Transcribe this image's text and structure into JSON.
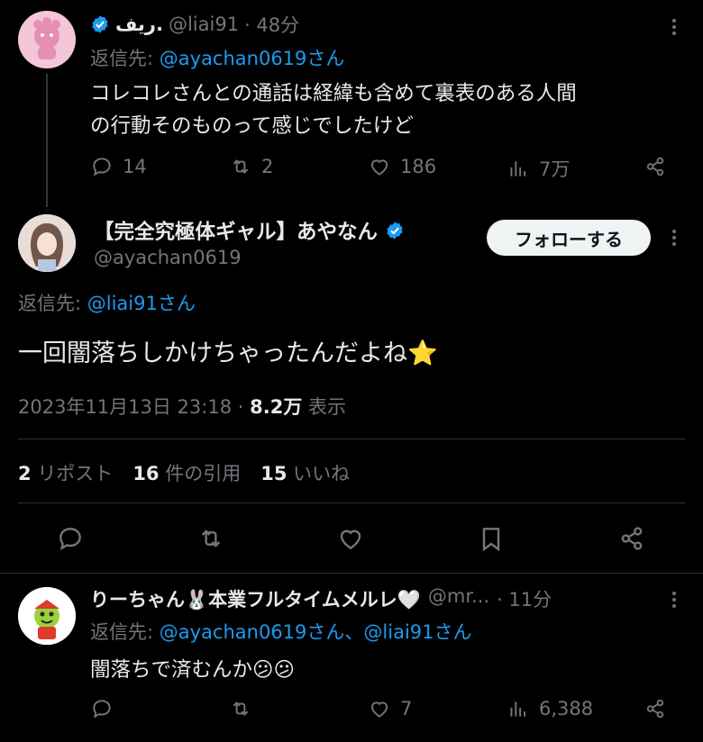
{
  "tweet1": {
    "display_name": "ريف.",
    "handle": "@liai91",
    "time": "· 48分",
    "reply_to_label": "返信先:",
    "reply_to_handle": "@ayachan0619さん",
    "text_line1": "コレコレさんとの通話は経緯も含めて裏表のある人間",
    "text_line2": "の行動そのものって感じでしたけど",
    "replies": "14",
    "reposts": "2",
    "likes": "186",
    "views": "7万"
  },
  "tweet2": {
    "display_name": "【完全究極体ギャル】あやなん",
    "handle": "@ayachan0619",
    "follow_label": "フォローする",
    "reply_to_label": "返信先:",
    "reply_to_handle": "@liai91さん",
    "text": "一回闇落ちしかけちゃったんだよね⭐",
    "timestamp": "2023年11月13日 23:18 ·",
    "views_count": "8.2万",
    "views_label": "表示",
    "reposts_count": "2",
    "reposts_label": "リポスト",
    "quotes_count": "16",
    "quotes_label": "件の引用",
    "likes_count": "15",
    "likes_label": "いいね"
  },
  "tweet3": {
    "display_name": "りーちゃん🐰本業フルタイムメルレ🤍",
    "handle": "@mr...",
    "time": "· 11分",
    "reply_to_label": "返信先:",
    "reply_to_handles": "@ayachan0619さん、@liai91さん",
    "text": "闇落ちで済むんか😕😕",
    "likes": "7",
    "views": "6,388"
  },
  "colors": {
    "background": "#000000",
    "text": "#e7e9ea",
    "secondary": "#71767b",
    "link": "#1d9bf0",
    "divider": "#2f3336"
  },
  "icons": [
    "verified-badge-icon",
    "reply-icon",
    "repost-icon",
    "like-icon",
    "views-icon",
    "share-icon",
    "bookmark-icon",
    "more-icon"
  ]
}
